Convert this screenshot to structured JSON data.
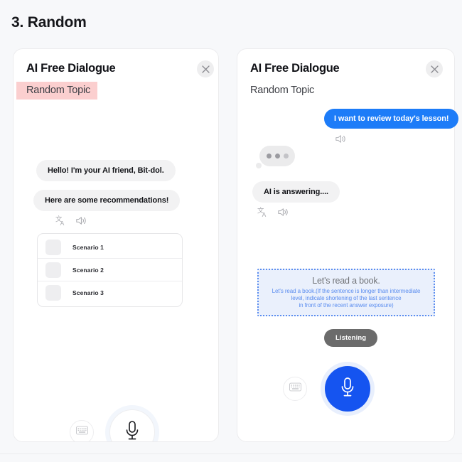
{
  "page": {
    "title": "3. Random"
  },
  "colors": {
    "background": "#f7f8fa",
    "accent_blue": "#1554f0",
    "user_bubble_blue": "#1d7cf8",
    "topic_highlight_pink": "#fbcfcf",
    "prompt_border_blue": "#5b8def",
    "prompt_fill_blue": "#eaf0fc",
    "listening_grey": "#6b6b6b"
  },
  "left_panel": {
    "title": "AI Free Dialogue",
    "close_icon": "close-icon",
    "topic": "Random Topic",
    "messages": [
      {
        "from": "ai",
        "text": "Hello! I'm your AI friend, Bit-dol."
      },
      {
        "from": "ai",
        "text": "Here are some recommendations!"
      }
    ],
    "message_actions": [
      {
        "icon": "translate-icon"
      },
      {
        "icon": "speaker-icon"
      }
    ],
    "scenarios": [
      {
        "label": "Scenario 1",
        "thumb": "thumbnail-placeholder"
      },
      {
        "label": "Scenario 2",
        "thumb": "thumbnail-placeholder"
      },
      {
        "label": "Scenario 3",
        "thumb": "thumbnail-placeholder"
      }
    ],
    "controls": {
      "keyboard_icon": "keyboard-icon",
      "mic_icon": "microphone-icon"
    }
  },
  "right_panel": {
    "title": "AI Free Dialogue",
    "close_icon": "close-icon",
    "topic": "Random Topic",
    "user_message": "I want to review today's lesson!",
    "user_message_actions": [
      {
        "icon": "speaker-icon"
      }
    ],
    "typing_indicator": "typing-dots",
    "ai_message": "AI is answering....",
    "ai_message_actions": [
      {
        "icon": "translate-icon"
      },
      {
        "icon": "speaker-icon"
      }
    ],
    "prompt": {
      "main": "Let's read a book.",
      "sub_line_1": "Let's read a book.(If the sentence is longer than intermediate",
      "sub_line_2": "level, indicate shortening of the last sentence",
      "sub_line_3": "in front of the recent answer exposure)"
    },
    "listening_label": "Listening",
    "controls": {
      "keyboard_icon": "keyboard-icon",
      "mic_icon": "microphone-icon"
    }
  }
}
